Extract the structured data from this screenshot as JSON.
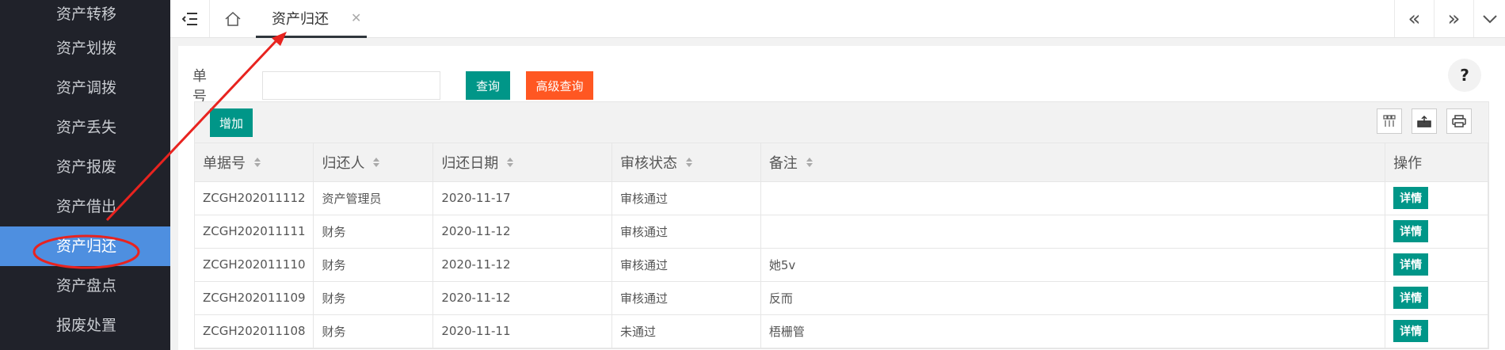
{
  "sidebar": {
    "items": [
      {
        "label": "资产转移"
      },
      {
        "label": "资产划拨"
      },
      {
        "label": "资产调拨"
      },
      {
        "label": "资产丢失"
      },
      {
        "label": "资产报废"
      },
      {
        "label": "资产借出"
      },
      {
        "label": "资产归还",
        "active": true
      },
      {
        "label": "资产盘点"
      },
      {
        "label": "报废处置"
      }
    ]
  },
  "topbar": {
    "active_tab": "资产归还",
    "menu_icon": "menu-fold-icon",
    "home_icon": "home-icon",
    "right_icons": [
      "double-chevron-left-icon",
      "double-chevron-right-icon",
      "chevron-down-icon"
    ]
  },
  "search": {
    "label": "单号",
    "input_value": "",
    "query_label": "查询",
    "advanced_label": "高级查询",
    "help_label": "?"
  },
  "toolbar": {
    "add_label": "增加",
    "icons": [
      "columns-icon",
      "export-icon",
      "print-icon"
    ]
  },
  "table": {
    "headers": [
      "单据号",
      "归还人",
      "归还日期",
      "审核状态",
      "备注",
      "操作"
    ],
    "rows": [
      {
        "id": "ZCGH202011112",
        "person": "资产管理员",
        "date": "2020-11-17",
        "status": "审核通过",
        "note": "",
        "action": "详情"
      },
      {
        "id": "ZCGH202011111",
        "person": "财务",
        "date": "2020-11-12",
        "status": "审核通过",
        "note": "",
        "action": "详情"
      },
      {
        "id": "ZCGH202011110",
        "person": "财务",
        "date": "2020-11-12",
        "status": "审核通过",
        "note": "她5v",
        "action": "详情"
      },
      {
        "id": "ZCGH202011109",
        "person": "财务",
        "date": "2020-11-12",
        "status": "审核通过",
        "note": "反而",
        "action": "详情"
      },
      {
        "id": "ZCGH202011108",
        "person": "财务",
        "date": "2020-11-11",
        "status": "未通过",
        "note": "梧栅管",
        "action": "详情"
      }
    ]
  },
  "colors": {
    "sidebar_bg": "#20222a",
    "sidebar_active": "#4e8fe0",
    "primary": "#009688",
    "warm": "#ff5722",
    "annotation_red": "#e8231f"
  }
}
